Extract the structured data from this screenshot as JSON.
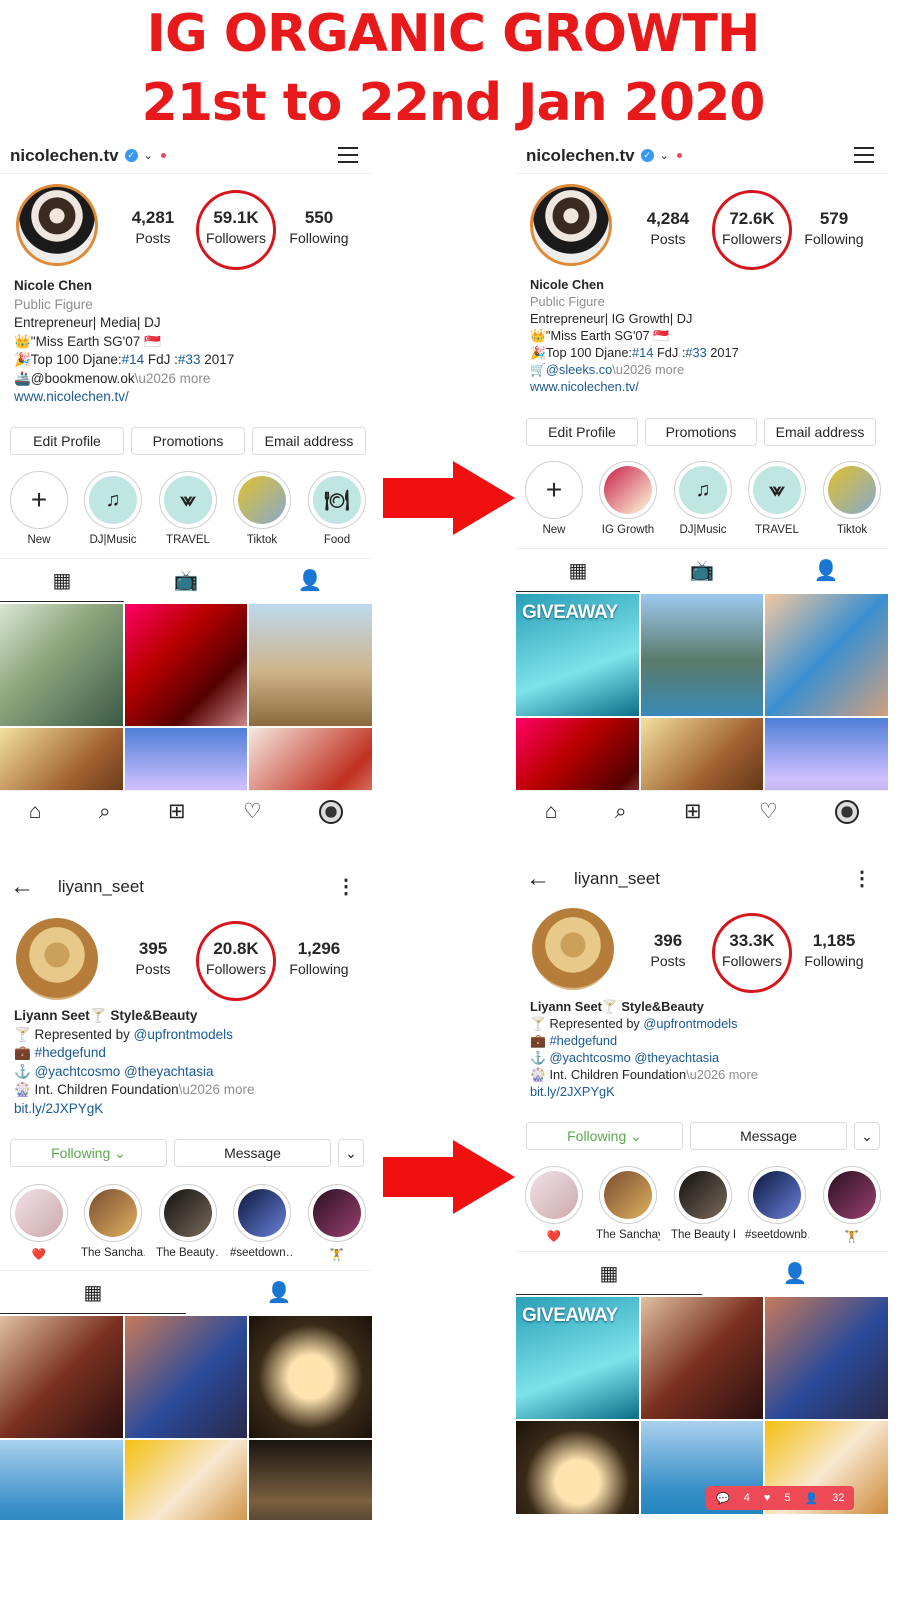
{
  "headline": {
    "line1": "IG  ORGANIC GROWTH",
    "line2": "21st to 22nd Jan 2020"
  },
  "colors": {
    "accent": "#e8191a",
    "ring": "#d8141c",
    "link": "#1a5a95",
    "following": "#59a94b",
    "verified": "#3897f0"
  },
  "nicole_before": {
    "username": "nicolechen.tv",
    "stats": {
      "posts": "4,281",
      "posts_label": "Posts",
      "followers": "59.1K",
      "followers_label": "Followers",
      "following": "550",
      "following_label": "Following"
    },
    "bio": [
      "Nicole Chen",
      "Public Figure",
      "Entrepreneur| Media| DJ",
      "👑\"Miss Earth SG'07 🇸🇬",
      "🎉Top 100 Djane:",
      "#14",
      " FdJ :",
      "#33",
      " 2017",
      "🚢@bookmenow.ok",
      "\\u2026 more",
      "www.nicolechen.tv/"
    ],
    "buttons": [
      "Edit Profile",
      "Promotions",
      "Email address"
    ],
    "highlights": [
      "New",
      "DJ|Music",
      "TRAVEL",
      "Tiktok",
      "Food"
    ]
  },
  "nicole_after": {
    "username": "nicolechen.tv",
    "stats": {
      "posts": "4,284",
      "posts_label": "Posts",
      "followers": "72.6K",
      "followers_label": "Followers",
      "following": "579",
      "following_label": "Following"
    },
    "bio": [
      "Nicole Chen",
      "Public Figure",
      "Entrepreneur| IG Growth| DJ",
      "👑\"Miss Earth SG'07 🇸🇬",
      "🎉Top 100 Djane:",
      "#14",
      " FdJ :",
      "#33",
      " 2017",
      "🛒@sleeks.co",
      "\\u2026 more",
      "www.nicolechen.tv/"
    ],
    "buttons": [
      "Edit Profile",
      "Promotions",
      "Email address"
    ],
    "highlights": [
      "New",
      "IG Growth",
      "DJ|Music",
      "TRAVEL",
      "Tiktok"
    ],
    "post_text": "GIVEAWAY"
  },
  "liyann_before": {
    "username": "liyann_seet",
    "stats": {
      "posts": "395",
      "posts_label": "Posts",
      "followers": "20.8K",
      "followers_label": "Followers",
      "following": "1,296",
      "following_label": "Following"
    },
    "bio": [
      "Liyann Seet🍸 Style&Beauty",
      "🍸 Represented by ",
      "@upfrontmodels",
      "💼 ",
      "#hedgefund",
      "⚓ ",
      "@yachtcosmo @theyachtasia",
      "🎡 Int. Children Foundation",
      "\\u2026 more",
      "bit.ly/2JXPYgK"
    ],
    "buttons": [
      "Following ⌄",
      "Message",
      "⌄"
    ],
    "highlights": [
      "❤️",
      "The Sancha…",
      "The Beauty…",
      "#seetdown…",
      "🏋"
    ]
  },
  "liyann_after": {
    "username": "liyann_seet",
    "stats": {
      "posts": "396",
      "posts_label": "Posts",
      "followers": "33.3K",
      "followers_label": "Followers",
      "following": "1,185",
      "following_label": "Following"
    },
    "bio": [
      "Liyann Seet🍸 Style&Beauty",
      "🍸 Represented by ",
      "@upfrontmodels",
      "💼 ",
      "#hedgefund",
      "⚓ ",
      "@yachtcosmo @theyachtasia",
      "🎡 Int. Children Foundation",
      "\\u2026 more",
      "bit.ly/2JXPYgK"
    ],
    "buttons": [
      "Following ⌄",
      "Message",
      "⌄"
    ],
    "highlights": [
      "❤️",
      "The Sanchaya",
      "The Beauty E…",
      "#seetdownb…",
      "🏋"
    ],
    "post_text": "GIVEAWAY",
    "notifications": {
      "comments": "4",
      "likes": "5",
      "follows": "32"
    }
  }
}
